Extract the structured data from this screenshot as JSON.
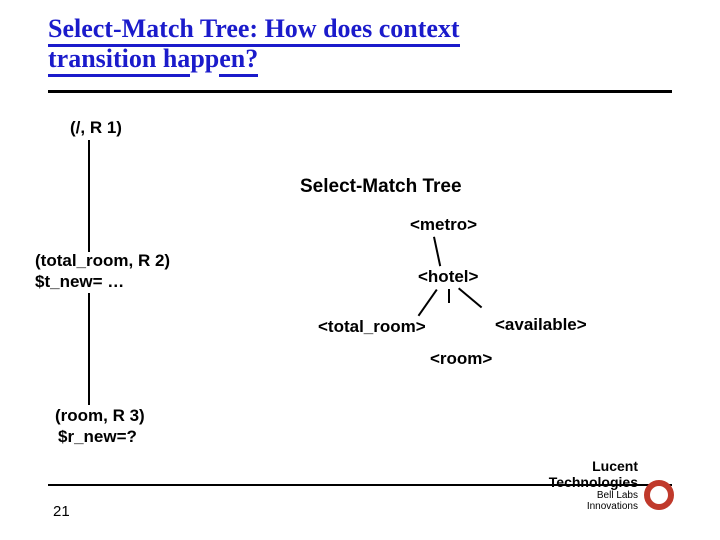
{
  "title_line1": "Select-Match Tree: How does context",
  "title_line2_a": "transition ha",
  "title_line2_b": "pp",
  "title_line2_c": "en?",
  "left": {
    "n1": "(/, R 1)",
    "n2a": "(total_room, R 2)",
    "n2b": "$t_new= …",
    "n3a": "(room, R 3)",
    "n3b": "$r_new=?"
  },
  "sm_title": "Select-Match Tree",
  "tree": {
    "metro": "<metro>",
    "hotel": "<hotel>",
    "total_room": "<total_room>",
    "available": "<available>",
    "room": "<room>"
  },
  "slide_number": "21",
  "logo": {
    "brand": "Lucent Technologies",
    "sub": "Bell Labs Innovations"
  }
}
